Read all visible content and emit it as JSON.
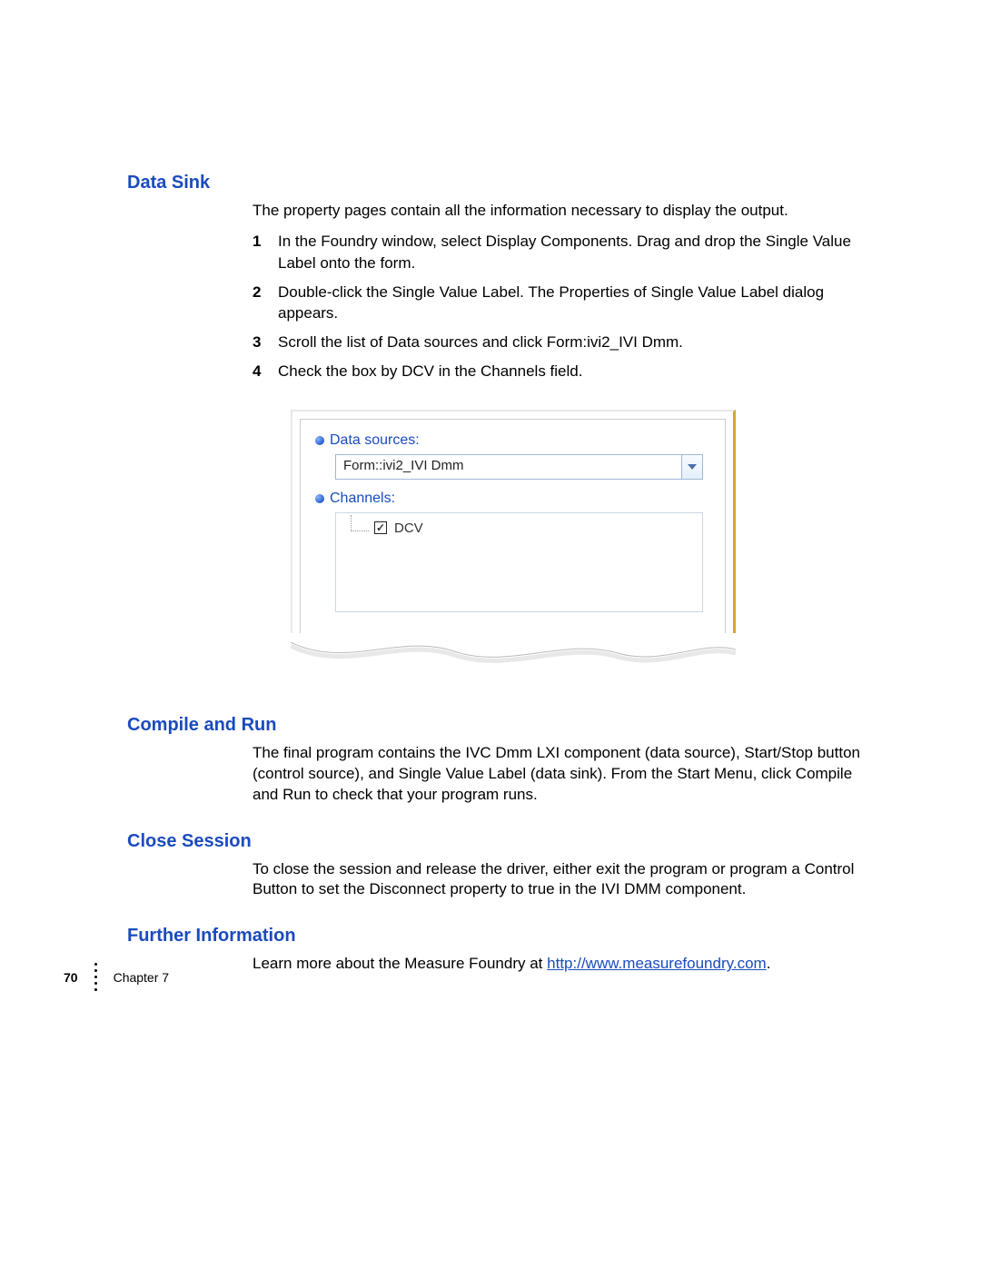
{
  "sections": {
    "dataSink": {
      "heading": "Data Sink",
      "intro": "The property pages contain all the information necessary to display the output.",
      "steps": {
        "n1": "1",
        "t1": "In the Foundry window, select Display Components. Drag and drop the Single Value Label onto the form.",
        "n2": "2",
        "t2": "Double-click the Single Value Label. The Properties of Single Value Label dialog appears.",
        "n3": "3",
        "t3": "Scroll the list of Data sources and click Form:ivi2_IVI Dmm.",
        "n4": "4",
        "t4": "Check the box by DCV in the Channels field."
      }
    },
    "compileRun": {
      "heading": "Compile and Run",
      "text": "The final program contains the IVC Dmm LXI component (data source), Start/Stop button (control source), and Single Value Label (data sink). From the Start Menu, click Compile and Run to check that your program runs."
    },
    "closeSession": {
      "heading": "Close Session",
      "text": "To close the session and release the driver, either exit the program or program a Control Button to set the Disconnect property to true in the IVI DMM component."
    },
    "furtherInfo": {
      "heading": "Further Information",
      "textPrefix": "Learn more about the Measure Foundry at ",
      "link": "http://www.measurefoundry.com",
      "textSuffix": "."
    }
  },
  "figure": {
    "dataSourcesLabel": "Data sources:",
    "dataSourcesValue": "Form::ivi2_IVI Dmm",
    "channelsLabel": "Channels:",
    "channelItem": "DCV",
    "channelChecked": "✓"
  },
  "footer": {
    "pageNumber": "70",
    "chapter": "Chapter 7"
  }
}
